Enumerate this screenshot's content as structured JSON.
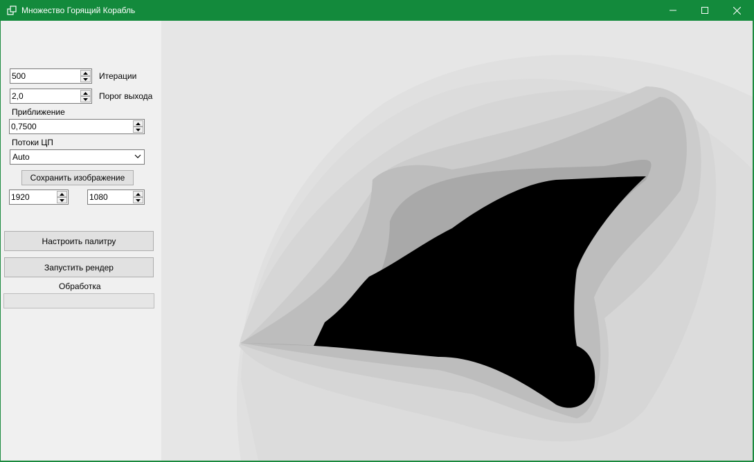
{
  "window": {
    "title": "Множество Горящий Корабль",
    "controls": [
      "minimize-icon",
      "maximize-icon",
      "close-icon"
    ]
  },
  "panel": {
    "iterations": {
      "value": "500",
      "label": "Итерации"
    },
    "escape": {
      "value": "2,0",
      "label": "Порог выхода"
    },
    "zoom": {
      "label": "Приближение",
      "value": "0,7500"
    },
    "threads": {
      "label": "Потоки ЦП",
      "value": "Auto"
    },
    "save_button": "Сохранить изображение",
    "width": {
      "value": "1920"
    },
    "height": {
      "value": "1080"
    },
    "palette_button": "Настроить палитру",
    "render_button": "Запустить рендер",
    "processing_label": "Обработка",
    "progress": 0
  },
  "colors": {
    "titlebar": "#138a3c",
    "panel": "#f0f0f0",
    "fractal_fill": "#000000"
  }
}
